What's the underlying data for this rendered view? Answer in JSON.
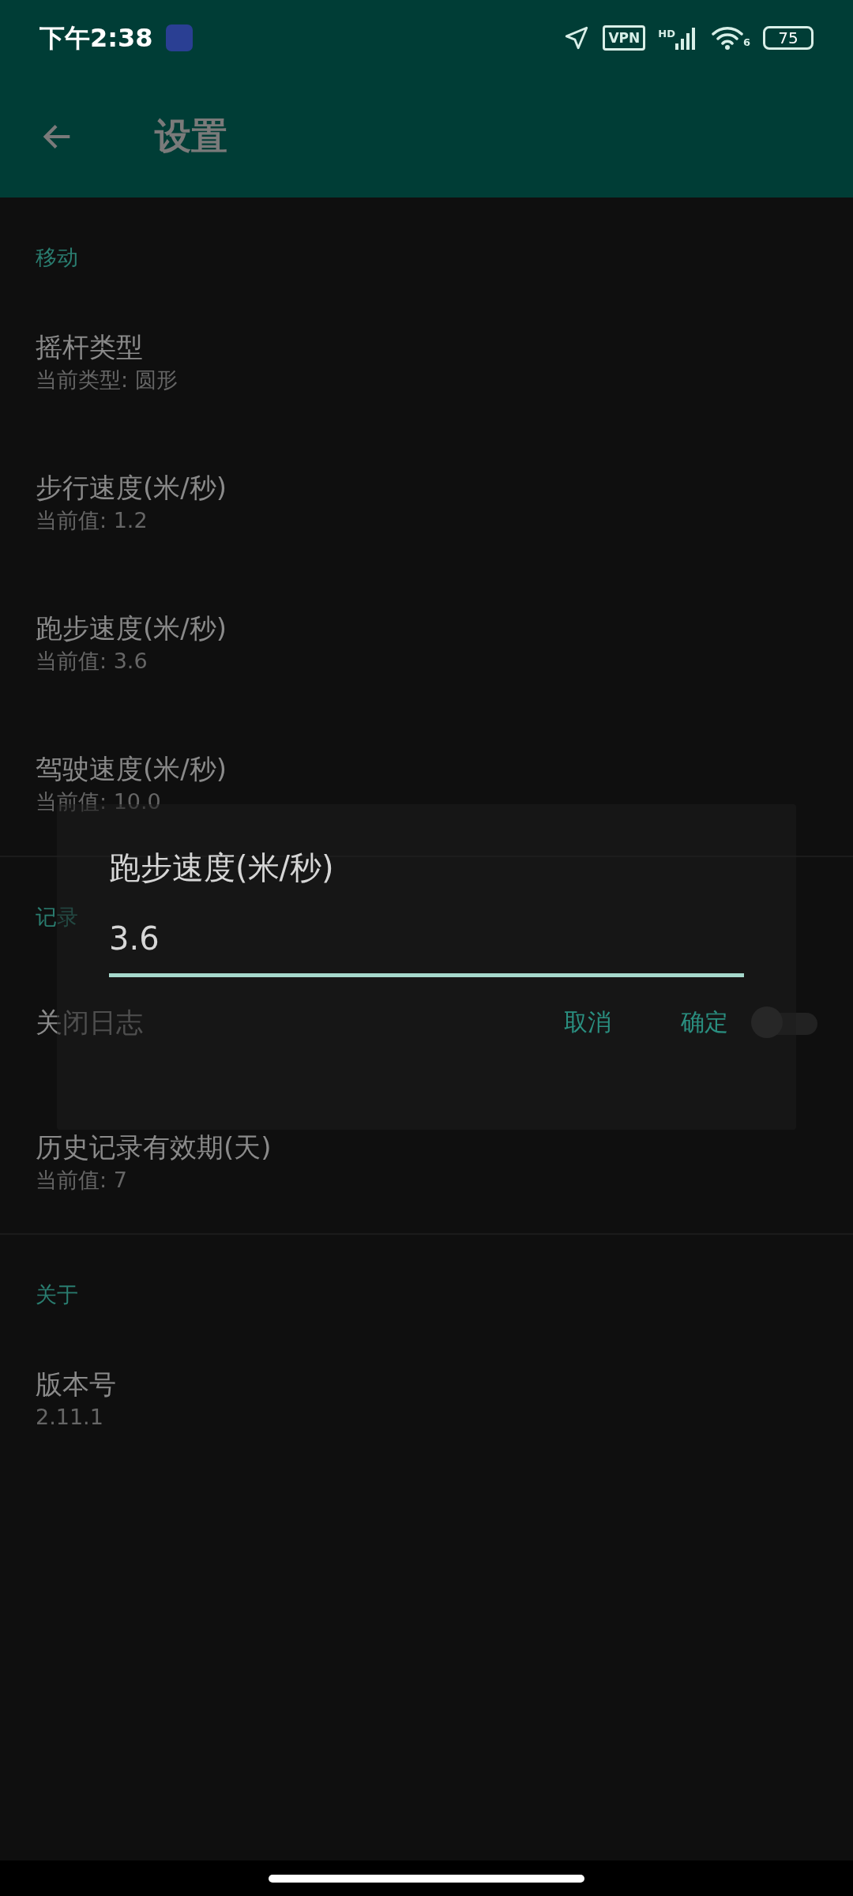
{
  "status_bar": {
    "time": "下午2:38",
    "vpn": "VPN",
    "network": "HD",
    "wifi_badge": "6",
    "battery": "75"
  },
  "app_bar": {
    "title": "设置"
  },
  "sections": [
    {
      "header": "移动",
      "items": [
        {
          "kind": "text",
          "title": "摇杆类型",
          "summary": "当前类型: 圆形"
        },
        {
          "kind": "text",
          "title": "步行速度(米/秒)",
          "summary": "当前值: 1.2"
        },
        {
          "kind": "text",
          "title": "跑步速度(米/秒)",
          "summary": "当前值: 3.6"
        },
        {
          "kind": "text",
          "title": "驾驶速度(米/秒)",
          "summary": "当前值: 10.0"
        }
      ]
    },
    {
      "header": "记录",
      "items": [
        {
          "kind": "switch",
          "title": "关闭日志",
          "checked": false
        },
        {
          "kind": "text",
          "title": "历史记录有效期(天)",
          "summary": "当前值: 7"
        }
      ]
    },
    {
      "header": "关于",
      "items": [
        {
          "kind": "text",
          "title": "版本号",
          "summary": "2.11.1"
        }
      ]
    }
  ],
  "dialog": {
    "title": "跑步速度(米/秒)",
    "value": "3.6",
    "buttons": [
      "取消",
      "确定"
    ]
  }
}
